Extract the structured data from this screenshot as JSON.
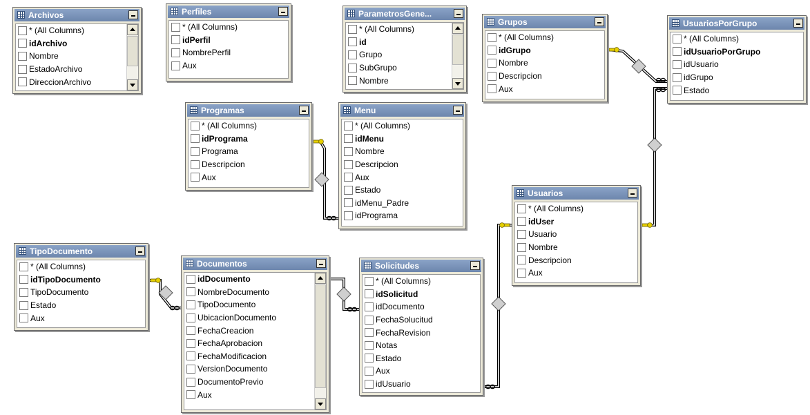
{
  "tables": [
    {
      "id": "archivos",
      "title": "Archivos",
      "scroll": true,
      "columns": [
        {
          "name": "* (All Columns)",
          "pk": false
        },
        {
          "name": "idArchivo",
          "pk": true
        },
        {
          "name": "Nombre",
          "pk": false
        },
        {
          "name": "EstadoArchivo",
          "pk": false
        },
        {
          "name": "DireccionArchivo",
          "pk": false
        }
      ]
    },
    {
      "id": "perfiles",
      "title": "Perfiles",
      "scroll": false,
      "columns": [
        {
          "name": "* (All Columns)",
          "pk": false
        },
        {
          "name": "idPerfil",
          "pk": true
        },
        {
          "name": "NombrePerfil",
          "pk": false
        },
        {
          "name": "Aux",
          "pk": false
        }
      ]
    },
    {
      "id": "parametros",
      "title": "ParametrosGene...",
      "scroll": true,
      "columns": [
        {
          "name": "* (All Columns)",
          "pk": false
        },
        {
          "name": "id",
          "pk": true
        },
        {
          "name": "Grupo",
          "pk": false
        },
        {
          "name": "SubGrupo",
          "pk": false
        },
        {
          "name": "Nombre",
          "pk": false
        }
      ]
    },
    {
      "id": "grupos",
      "title": "Grupos",
      "scroll": false,
      "columns": [
        {
          "name": "* (All Columns)",
          "pk": false
        },
        {
          "name": "idGrupo",
          "pk": true
        },
        {
          "name": "Nombre",
          "pk": false
        },
        {
          "name": "Descripcion",
          "pk": false
        },
        {
          "name": "Aux",
          "pk": false
        }
      ]
    },
    {
      "id": "usuariosporgrupo",
      "title": "UsuariosPorGrupo",
      "scroll": false,
      "columns": [
        {
          "name": "* (All Columns)",
          "pk": false
        },
        {
          "name": "idUsuarioPorGrupo",
          "pk": true
        },
        {
          "name": "idUsuario",
          "pk": false
        },
        {
          "name": "idGrupo",
          "pk": false
        },
        {
          "name": "Estado",
          "pk": false
        }
      ]
    },
    {
      "id": "programas",
      "title": "Programas",
      "scroll": false,
      "columns": [
        {
          "name": "* (All Columns)",
          "pk": false
        },
        {
          "name": "idPrograma",
          "pk": true
        },
        {
          "name": "Programa",
          "pk": false
        },
        {
          "name": "Descripcion",
          "pk": false
        },
        {
          "name": "Aux",
          "pk": false
        }
      ]
    },
    {
      "id": "menu",
      "title": "Menu",
      "scroll": false,
      "columns": [
        {
          "name": "* (All Columns)",
          "pk": false
        },
        {
          "name": "idMenu",
          "pk": true
        },
        {
          "name": "Nombre",
          "pk": false
        },
        {
          "name": "Descripcion",
          "pk": false
        },
        {
          "name": "Aux",
          "pk": false
        },
        {
          "name": "Estado",
          "pk": false
        },
        {
          "name": "idMenu_Padre",
          "pk": false
        },
        {
          "name": "idPrograma",
          "pk": false
        }
      ]
    },
    {
      "id": "usuarios",
      "title": "Usuarios",
      "scroll": false,
      "columns": [
        {
          "name": "* (All Columns)",
          "pk": false
        },
        {
          "name": "idUser",
          "pk": true
        },
        {
          "name": "Usuario",
          "pk": false
        },
        {
          "name": "Nombre",
          "pk": false
        },
        {
          "name": "Descripcion",
          "pk": false
        },
        {
          "name": "Aux",
          "pk": false
        }
      ]
    },
    {
      "id": "tipodocumento",
      "title": "TipoDocumento",
      "scroll": false,
      "columns": [
        {
          "name": "* (All Columns)",
          "pk": false
        },
        {
          "name": "idTipoDocumento",
          "pk": true
        },
        {
          "name": "TipoDocumento",
          "pk": false
        },
        {
          "name": "Estado",
          "pk": false
        },
        {
          "name": "Aux",
          "pk": false
        }
      ]
    },
    {
      "id": "documentos",
      "title": "Documentos",
      "scroll": true,
      "columns": [
        {
          "name": "idDocumento",
          "pk": true
        },
        {
          "name": "NombreDocumento",
          "pk": false
        },
        {
          "name": "TipoDocumento",
          "pk": false
        },
        {
          "name": "UbicacionDocumento",
          "pk": false
        },
        {
          "name": "FechaCreacion",
          "pk": false
        },
        {
          "name": "FechaAprobacion",
          "pk": false
        },
        {
          "name": "FechaModificacion",
          "pk": false
        },
        {
          "name": "VersionDocumento",
          "pk": false
        },
        {
          "name": "DocumentoPrevio",
          "pk": false
        },
        {
          "name": "Aux",
          "pk": false
        }
      ]
    },
    {
      "id": "solicitudes",
      "title": "Solicitudes",
      "scroll": false,
      "columns": [
        {
          "name": "* (All Columns)",
          "pk": false
        },
        {
          "name": "idSolicitud",
          "pk": true
        },
        {
          "name": "idDocumento",
          "pk": false
        },
        {
          "name": "FechaSolucitud",
          "pk": false
        },
        {
          "name": "FechaRevision",
          "pk": false
        },
        {
          "name": "Notas",
          "pk": false
        },
        {
          "name": "Estado",
          "pk": false
        },
        {
          "name": "Aux",
          "pk": false
        },
        {
          "name": "idUsuario",
          "pk": false
        }
      ]
    }
  ],
  "relationships": [
    {
      "from": "grupos",
      "to": "usuariosporgrupo"
    },
    {
      "from": "usuarios",
      "to": "usuariosporgrupo"
    },
    {
      "from": "programas",
      "to": "menu"
    },
    {
      "from": "tipodocumento",
      "to": "documentos"
    },
    {
      "from": "documentos",
      "to": "solicitudes"
    },
    {
      "from": "usuarios",
      "to": "solicitudes"
    }
  ],
  "colors": {
    "title_bar": "#7790b8",
    "key_symbol": "#e6d000",
    "diamond": "#cfcfcf",
    "frame": "#ece9d8"
  }
}
